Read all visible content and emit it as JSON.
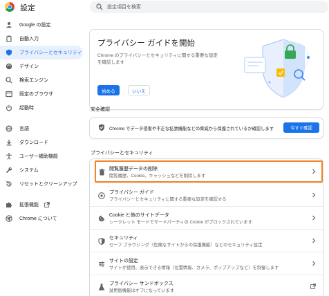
{
  "header": {
    "title": "設定",
    "search_placeholder": "設定項目を検索"
  },
  "sidebar": {
    "items": [
      {
        "label": "Google の設定",
        "icon": "person-icon"
      },
      {
        "label": "自動入力",
        "icon": "clipboard-icon"
      },
      {
        "label": "プライバシーとセキュリティ",
        "icon": "shield-icon",
        "active": true
      },
      {
        "label": "デザイン",
        "icon": "palette-icon"
      },
      {
        "label": "検索エンジン",
        "icon": "search-icon"
      },
      {
        "label": "既定のブラウザ",
        "icon": "browser-icon"
      },
      {
        "label": "起動時",
        "icon": "power-icon"
      },
      {
        "label": "言語",
        "icon": "globe-icon"
      },
      {
        "label": "ダウンロード",
        "icon": "download-icon"
      },
      {
        "label": "ユーザー補助機能",
        "icon": "accessibility-icon"
      },
      {
        "label": "システム",
        "icon": "wrench-icon"
      },
      {
        "label": "リセットとクリーンアップ",
        "icon": "reset-icon"
      },
      {
        "label": "拡張機能",
        "icon": "puzzle-icon"
      },
      {
        "label": "Chrome について",
        "icon": "chrome-icon"
      }
    ]
  },
  "guide": {
    "title": "プライバシー ガイドを開始",
    "description": "Chrome のプライバシーとセキュリティに関する重要な設定を確認します",
    "start_label": "始める",
    "decline_label": "いいえ"
  },
  "safety": {
    "section_title": "安全確認",
    "text": "Chrome でデータ侵害や不正な拡張機能などの脅威から保護されているか確認します",
    "button_label": "今すぐ確認"
  },
  "privacy": {
    "section_title": "プライバシーとセキュリティ",
    "rows": [
      {
        "title": "閲覧履歴データの削除",
        "subtitle": "閲覧履歴、Cookie、キャッシュなどを削除します",
        "icon": "trash-icon"
      },
      {
        "title": "プライバシー ガイド",
        "subtitle": "プライバシーとセキュリティに関する重要な設定を確認する",
        "icon": "guide-icon"
      },
      {
        "title": "Cookie と他のサイトデータ",
        "subtitle": "シークレット モードでサードパーティの Cookie がブロックされています",
        "icon": "cookie-icon"
      },
      {
        "title": "セキュリティ",
        "subtitle": "セーフ ブラウジング（危険なサイトからの保護機能）などのセキュリティ設定",
        "icon": "shield-icon"
      },
      {
        "title": "サイトの設定",
        "subtitle": "サイトが使用、表示できる情報（位置情報、カメラ、ポップアップなど）を制御します",
        "icon": "sliders-icon"
      },
      {
        "title": "プライバシー サンドボックス",
        "subtitle": "試用版機能はオフになっています",
        "icon": "flask-icon"
      }
    ]
  },
  "colors": {
    "accent": "#1a73e8",
    "highlight": "#f0832b",
    "active_bg": "#e8f0fe"
  }
}
